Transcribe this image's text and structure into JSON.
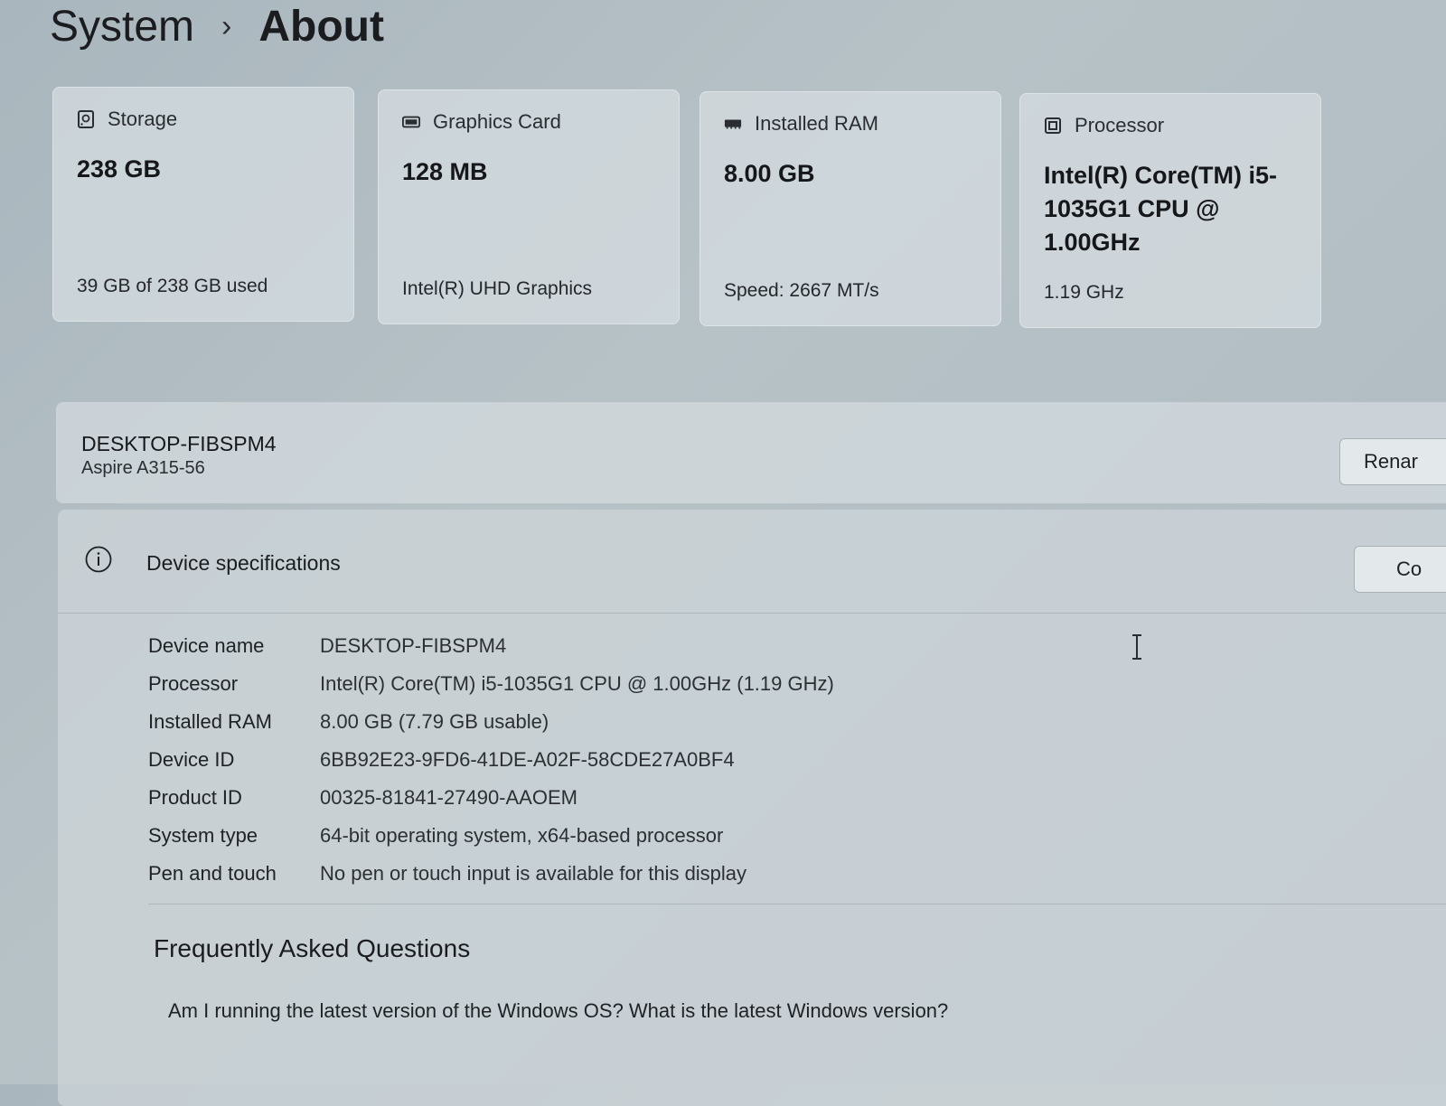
{
  "breadcrumb": {
    "parent": "System",
    "separator": "›",
    "current": "About"
  },
  "cards": [
    {
      "title": "Storage",
      "value": "238 GB",
      "sub": "39 GB of 238 GB used",
      "icon": "storage-icon"
    },
    {
      "title": "Graphics Card",
      "value": "128 MB",
      "sub": "Intel(R) UHD Graphics",
      "icon": "graphics-card-icon"
    },
    {
      "title": "Installed RAM",
      "value": "8.00 GB",
      "sub": "Speed: 2667 MT/s",
      "icon": "ram-icon"
    },
    {
      "title": "Processor",
      "value": "Intel(R) Core(TM) i5-1035G1 CPU @ 1.00GHz",
      "sub": "1.19 GHz",
      "icon": "processor-icon"
    }
  ],
  "device": {
    "name": "DESKTOP-FIBSPM4",
    "model": "Aspire A315-56",
    "rename_label": "Renar"
  },
  "specs": {
    "title": "Device specifications",
    "copy_label": "Co",
    "rows": [
      {
        "label": "Device name",
        "value": "DESKTOP-FIBSPM4"
      },
      {
        "label": "Processor",
        "value": "Intel(R) Core(TM) i5-1035G1 CPU @ 1.00GHz (1.19 GHz)"
      },
      {
        "label": "Installed RAM",
        "value": "8.00 GB (7.79 GB usable)"
      },
      {
        "label": "Device ID",
        "value": "6BB92E23-9FD6-41DE-A02F-58CDE27A0BF4"
      },
      {
        "label": "Product ID",
        "value": "00325-81841-27490-AAOEM"
      },
      {
        "label": "System type",
        "value": "64-bit operating system, x64-based processor"
      },
      {
        "label": "Pen and touch",
        "value": "No pen or touch input is available for this display"
      }
    ]
  },
  "faq": {
    "title": "Frequently Asked Questions",
    "question": "Am I running the latest version of the Windows OS? What is the latest Windows version?"
  }
}
